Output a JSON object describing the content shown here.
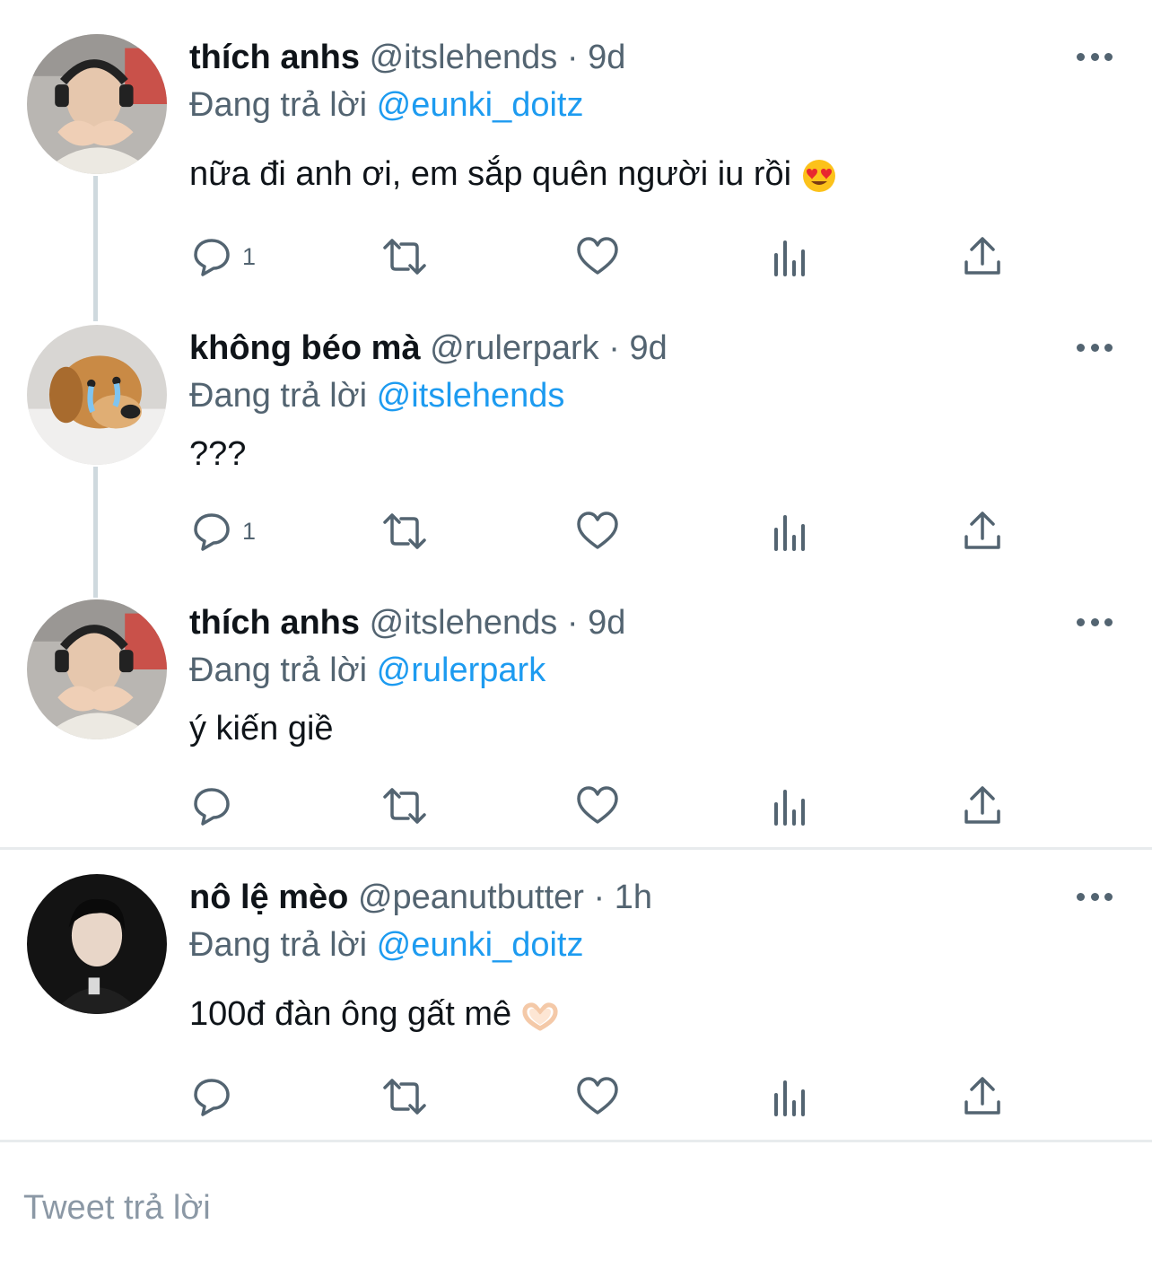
{
  "tweets": [
    {
      "name": "thích anhs",
      "handle": "@itslehends",
      "sep": "·",
      "time": "9d",
      "reply_prefix": "Đang trả lời",
      "reply_to": "@eunki_doitz",
      "text": "nữa đi anh ơi, em sắp quên người iu rồi",
      "emoji": "heart-eyes-emoji",
      "reply_count": "1",
      "avatar": "boy-heart-hands-avatar"
    },
    {
      "name": "không béo mà",
      "handle": "@rulerpark",
      "sep": "·",
      "time": "9d",
      "reply_prefix": "Đang trả lời",
      "reply_to": "@itslehends",
      "text": "???",
      "reply_count": "1",
      "avatar": "crying-dog-avatar"
    },
    {
      "name": "thích anhs",
      "handle": "@itslehends",
      "sep": "·",
      "time": "9d",
      "reply_prefix": "Đang trả lời",
      "reply_to": "@rulerpark",
      "text": "ý kiến giề",
      "reply_count": "",
      "avatar": "boy-heart-hands-avatar"
    },
    {
      "name": "nô lệ mèo",
      "handle": "@peanutbutter",
      "sep": "·",
      "time": "1h",
      "reply_prefix": "Đang trả lời",
      "reply_to": "@eunki_doitz",
      "text": "100đ đàn ông gất mê",
      "emoji": "heart-hands-emoji",
      "reply_count": "",
      "avatar": "dark-portrait-avatar"
    }
  ],
  "compose": {
    "placeholder": "Tweet trả lời"
  },
  "colors": {
    "link": "#1d9bf0",
    "secondary": "#536471",
    "text": "#0f1419",
    "thread": "#cfd9de"
  }
}
